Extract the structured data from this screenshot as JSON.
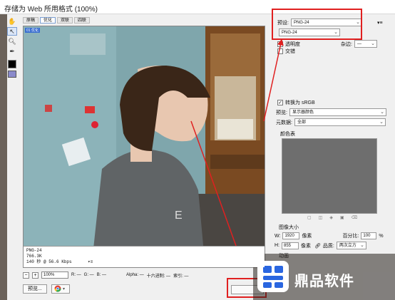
{
  "window": {
    "title": "存储为 Web 所用格式 (100%)"
  },
  "tabs": [
    "原稿",
    "优化",
    "双联",
    "四联"
  ],
  "preview": {
    "tag": "01 优化",
    "info_lines": [
      "PNG-24",
      "766.3K",
      "140 秒 @ 56.6 Kbps"
    ],
    "info_menu": "▾≡"
  },
  "statusbar": {
    "minus": "−",
    "plus": "+",
    "zoom": "100%",
    "r": "R: —",
    "g": "G: —",
    "b": "B: —",
    "alpha": "Alpha: —",
    "hex": "十六进制: —",
    "index": "索引: —"
  },
  "bottombar": {
    "preview_label": "预览...",
    "browser_icon": "chrome-icon"
  },
  "right_panel": {
    "preset_label": "预设:",
    "preset_value": "PNG-24",
    "format_value": "PNG-24",
    "transparency_label": "透明度",
    "transparency_checked": true,
    "matte_label": "杂边:",
    "matte_value": "—",
    "interlaced_label": "交错",
    "interlaced_checked": false,
    "srgb_label": "转换为 sRGB",
    "srgb_checked": true,
    "preview_label": "预览:",
    "preview_value": "显示器颜色",
    "metadata_label": "元数据:",
    "metadata_value": "全部",
    "color_table_label": "颜色表",
    "image_size_label": "图像大小",
    "w_label": "W:",
    "w_value": "1920",
    "w_unit": "像素",
    "h_label": "H:",
    "h_value": "855",
    "h_unit": "像素",
    "percent_label": "百分比:",
    "percent_value": "100",
    "percent_unit": "%",
    "quality_label": "品质:",
    "quality_value": "两次立方",
    "animation_label": "动画"
  },
  "watermark": {
    "text": "鼎品软件"
  },
  "colors": {
    "annotation_red": "#e02020",
    "accent_blue": "#3a6fd0",
    "logo_blue": "#2a66e0"
  }
}
